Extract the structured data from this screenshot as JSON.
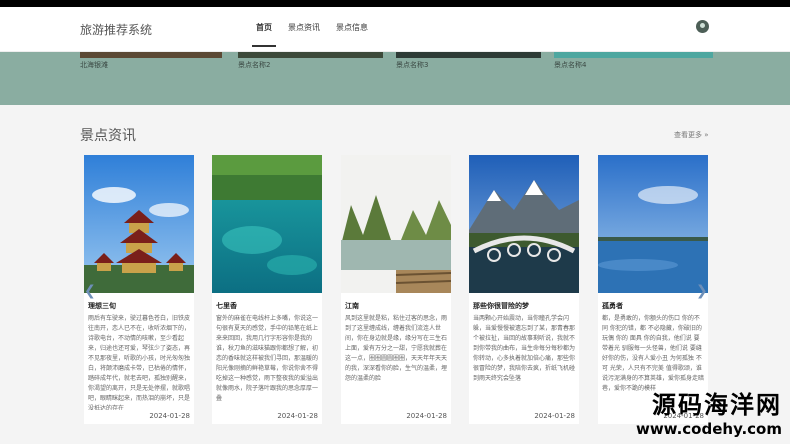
{
  "header": {
    "brand": "旅游推荐系统",
    "nav": [
      "首页",
      "景点资讯",
      "景点信息"
    ],
    "avatar_icon": "user-icon"
  },
  "band": {
    "labels": [
      "北海银滩",
      "景点名称2",
      "景点名称3",
      "景点名称4"
    ]
  },
  "section": {
    "title": "景点资讯",
    "more": "查看更多 »"
  },
  "cards": [
    {
      "title": "理想三旬",
      "text": "雨后有车驶来，驶过暮色苍白，旧铁皮往南开，恋人已不在，收听浓烟下的，诗歌电台，不动情的咳嗽，至少看起来，归途也还可爱，琴弦少了姿态，再不见那夜里，听歌的小孩，时光匆匆独白，将颠沛磨成卡带，已枯倦的情怀，踏碎成年代，就老去吧，孤独别醒来，你渴望的离开，只是无处停摆，就歌唱吧，眼睛眯起来，而热泪的崩坏，只是没抵达的存在",
      "date": "2024-01-28"
    },
    {
      "title": "七里香",
      "text": "窗外的麻雀在电线杆上多嘴，你说这一句很有夏天的感觉，手中的铅笔在纸上来来回回，我用几行字形容你是我的谁，秋刀鱼的滋味猫跟你都想了解，初恋的香味就这样被我们寻回，那温暖的阳光像刚摘的鲜艳草莓，你说你舍不得吃掉这一种感觉，雨下整夜我的爱溢出就像雨水，院子落叶跟我的思念厚厚一叠",
      "date": "2024-01-28"
    },
    {
      "title": "江南",
      "text": "风到这里就是粘，粘住过客的思念，雨到了这里缠成线，缠着我们流连人世间，你在身边就是缘，缘分写在三生石上面，爱有万分之一甜，宁愿我就葬在这一点，圈圈圆圆圈圈，天天年年天天的我，深深看你的脸，生气的温柔，埋怨的温柔的脸",
      "date": "2024-01-28"
    },
    {
      "title": "那些你很冒险的梦",
      "text": "当两颗心开始震动，当你瞳孔学会闪躲，当爱慢慢被遗忘到了某，那青春那个被拉扯，当回的故事剩听说，我就不到你带我的曲布，当生命每分每秒都为你转动，心多执着就加倍心痛，那些你很冒险的梦，我陪你去疯，折纸飞机碰到雨天终究会坠落",
      "date": "2024-01-28"
    },
    {
      "title": "孤勇者",
      "text": "都，是勇敢的，你额头的伤口 你的不同 你犯的错，都 不必隐藏，你破旧的玩偶 你的 面具 你的自我，他们说 要带着光 驯服每一头怪兽，他们说 要缝好你的伤，没有人爱小丑 为何孤独 不可 光荣，人只有不完美 值得歌颂，谁说污泥满身的不算英雄，爱你孤身走暗巷，爱你不跪的模样",
      "date": "2024-01-28"
    }
  ],
  "watermark": {
    "line1": "源码海洋网",
    "line2": "www.codehy.com"
  },
  "colors": {
    "band": "#8aada1",
    "section_bg": "#f4f4f4",
    "arrow": "#6d8fb8"
  }
}
